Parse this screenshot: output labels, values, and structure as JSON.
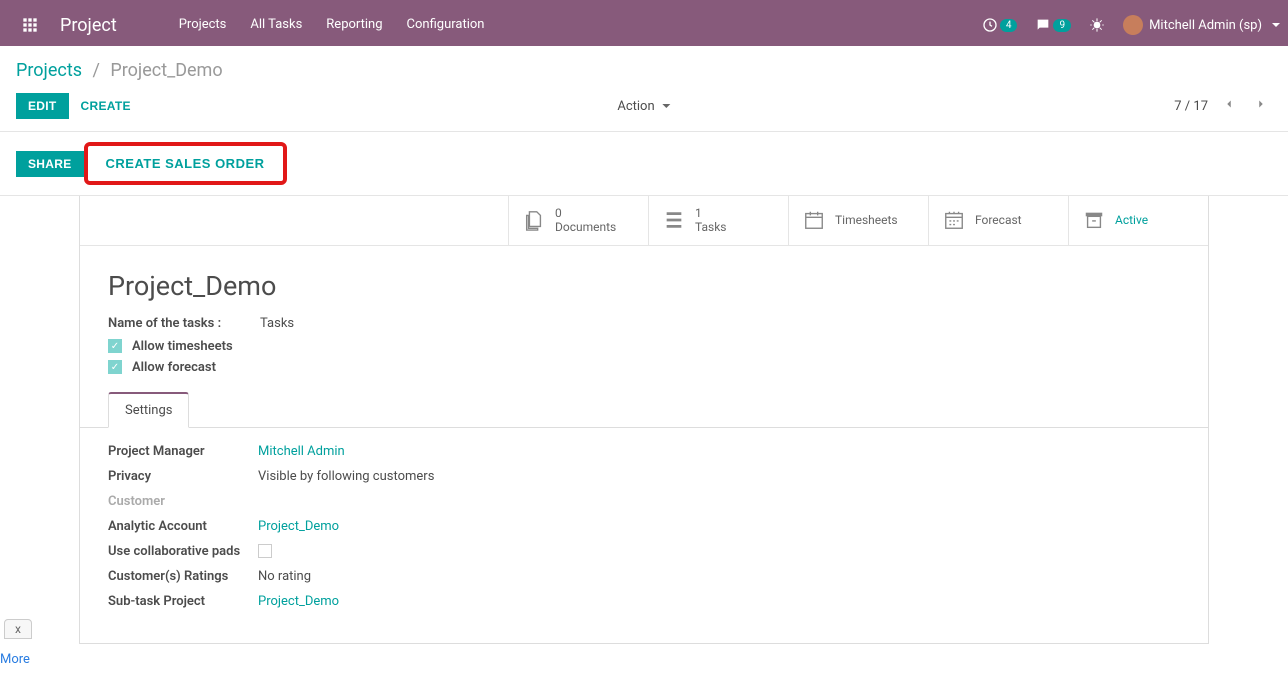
{
  "header": {
    "app_title": "Project",
    "nav": [
      "Projects",
      "All Tasks",
      "Reporting",
      "Configuration"
    ],
    "clock_badge": "4",
    "chat_badge": "9",
    "user": "Mitchell Admin (sp)"
  },
  "breadcrumb": {
    "link": "Projects",
    "current": "Project_Demo"
  },
  "actions": {
    "edit": "EDIT",
    "create": "CREATE",
    "action": "Action",
    "pager": "7 / 17",
    "share": "SHARE",
    "create_sales_order": "CREATE SALES ORDER"
  },
  "stats": {
    "documents": {
      "count": "0",
      "label": "Documents"
    },
    "tasks": {
      "count": "1",
      "label": "Tasks"
    },
    "timesheets": {
      "label": "Timesheets"
    },
    "forecast": {
      "label": "Forecast"
    },
    "active": {
      "label": "Active"
    }
  },
  "project": {
    "title": "Project_Demo",
    "tasks_field_label": "Name of the tasks :",
    "tasks_field_value": "Tasks",
    "allow_timesheets": "Allow timesheets",
    "allow_forecast": "Allow forecast"
  },
  "tabs": {
    "settings": "Settings"
  },
  "settings": {
    "labels": {
      "manager": "Project Manager",
      "privacy": "Privacy",
      "customer": "Customer",
      "analytic": "Analytic Account",
      "collab": "Use collaborative pads",
      "ratings": "Customer(s) Ratings",
      "subtask": "Sub-task Project"
    },
    "values": {
      "manager": "Mitchell Admin",
      "privacy": "Visible by following customers",
      "analytic": "Project_Demo",
      "ratings": "No rating",
      "subtask": "Project_Demo"
    }
  },
  "bottom": {
    "x": "x",
    "more": "More"
  }
}
